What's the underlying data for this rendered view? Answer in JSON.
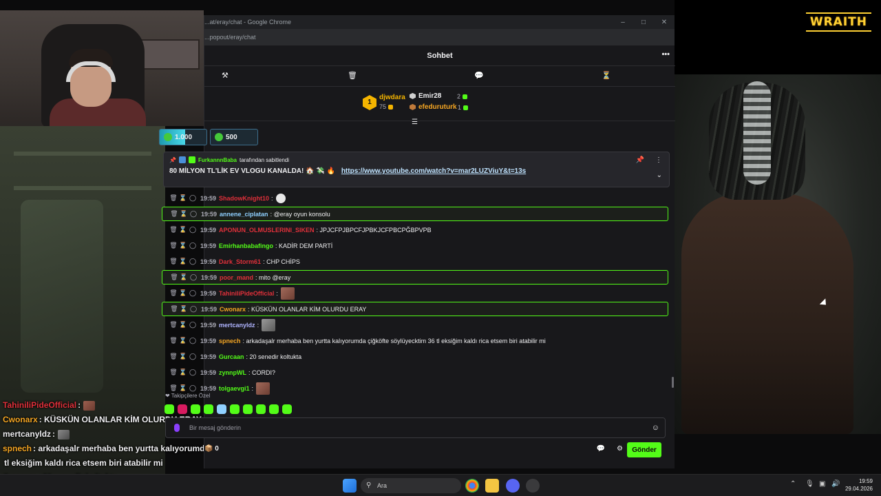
{
  "brand": {
    "logo_text": "WRAITH",
    "accent": "#53fc18",
    "logo_color": "#ffd133"
  },
  "browser": {
    "title": "...at/eray/chat - Google Chrome",
    "address": "...popout/eray/chat",
    "controls": {
      "minimize": "–",
      "maximize": "□",
      "close": "✕"
    }
  },
  "chat": {
    "header_title": "Sohbet",
    "more_label": "•••",
    "mod_tools": [
      {
        "icon": "gavel-icon",
        "glyph": "⚒"
      },
      {
        "icon": "trash-icon",
        "glyph": "🗑"
      },
      {
        "icon": "chat-icon",
        "glyph": "💬"
      },
      {
        "icon": "hourglass-icon",
        "glyph": "⏳"
      }
    ],
    "leaderboard": {
      "first": {
        "rank": "1",
        "name": "djwdara",
        "points": "75"
      },
      "second": {
        "name": "Emir28",
        "points": "2"
      },
      "third": {
        "name": "efeduruturk",
        "points": "1"
      }
    },
    "points": [
      {
        "label": "1.000",
        "progress": 0.55
      },
      {
        "label": "500",
        "progress": 0.0
      }
    ],
    "pinned": {
      "by_user": "FurkannnBaba",
      "by_text": "tarafından sabitlendi",
      "message": "80 MİLYON TL'LİK EV VLOGU KANALDA! 🏠 💸 🔥",
      "link": "https://www.youtube.com/watch?v=mar2LUZViuY&t=13s"
    },
    "messages": [
      {
        "time": "19:59",
        "user": "ShadowKnight10",
        "color": "#e0303a",
        "text": "",
        "emote": "skull",
        "hl": false
      },
      {
        "time": "19:59",
        "user": "annene_ciplatan",
        "color": "#8fd0ff",
        "text": "@eray oyun konsolu",
        "hl": true
      },
      {
        "time": "19:59",
        "user": "APONUN_OLMUSLERINI_SIKEN",
        "color": "#e0303a",
        "text": "JPJCFPJBPCFJPBKJCFPBCPĞBPVPB",
        "hl": false
      },
      {
        "time": "19:59",
        "user": "Emirhanbabafingo",
        "color": "#53fc18",
        "text": "KADİR DEM PARTİ",
        "hl": false
      },
      {
        "time": "19:59",
        "user": "Dark_Storm61",
        "color": "#e0303a",
        "text": "CHP CHİPS",
        "hl": false
      },
      {
        "time": "19:59",
        "user": "poor_mand",
        "color": "#e0303a",
        "text": "mito @eray",
        "hl": true
      },
      {
        "time": "19:59",
        "user": "TahiniliPideOfficial",
        "color": "#e0303a",
        "text": "",
        "emote": "pic",
        "hl": false
      },
      {
        "time": "19:59",
        "user": "Cwonarx",
        "color": "#f5a623",
        "text": "KÜSKÜN OLANLAR KİM OLURDU ERAY",
        "hl": true
      },
      {
        "time": "19:59",
        "user": "mertcanyldz",
        "color": "#b0b4ff",
        "text": "",
        "emote": "gray",
        "hl": false
      },
      {
        "time": "19:59",
        "user": "spnech",
        "color": "#f5a623",
        "text": "arkadaşalr merhaba ben yurtta kalıyorumda çiğköfte söylüyecktim 36 tl eksiğim kaldı rica etsem biri atabilir mi",
        "hl": false
      },
      {
        "time": "19:59",
        "user": "Gurcaan",
        "color": "#53fc18",
        "text": "20 senedir koltukta",
        "hl": false
      },
      {
        "time": "19:59",
        "user": "zynnpWL",
        "color": "#53fc18",
        "text": "CORDI?",
        "hl": false
      },
      {
        "time": "19:59",
        "user": "tolgaevgi1",
        "color": "#53fc18",
        "text": "",
        "emote": "pic",
        "hl": false
      }
    ],
    "followers_label": "❤ Takipçilere Özel",
    "input_placeholder": "Bir mesaj gönderin",
    "bottom": {
      "count": "0",
      "send_label": "Gönder"
    }
  },
  "overlay": [
    {
      "user": "TahiniliPideOfficial",
      "color": "#e0303a",
      "text": ":",
      "emote": "pic"
    },
    {
      "user": "Cwonarx",
      "color": "#f5a623",
      "text": ": KÜSKÜN OLANLAR KİM OLURDU ERAY"
    },
    {
      "user": "mertcanyldz",
      "color": "#efeff1",
      "text": ":",
      "emote": "gray"
    },
    {
      "user": "spnech",
      "color": "#f5a623",
      "text": ": arkadaşalr merhaba ben yurtta kalıyorumda"
    },
    {
      "user": "",
      "color": "#efeff1",
      "text": "tl eksiğim kaldı rica etsem biri atabilir mi"
    },
    {
      "user": "Gurcaan",
      "color": "#53fc18",
      "text": ": 20 senedir koltukta"
    },
    {
      "user": "zynnpWL",
      "color": "#53fc18",
      "text": ": CORDI?"
    }
  ],
  "taskbar": {
    "search_label": "Ara",
    "time": "19:59",
    "date": "29.04.2026"
  }
}
